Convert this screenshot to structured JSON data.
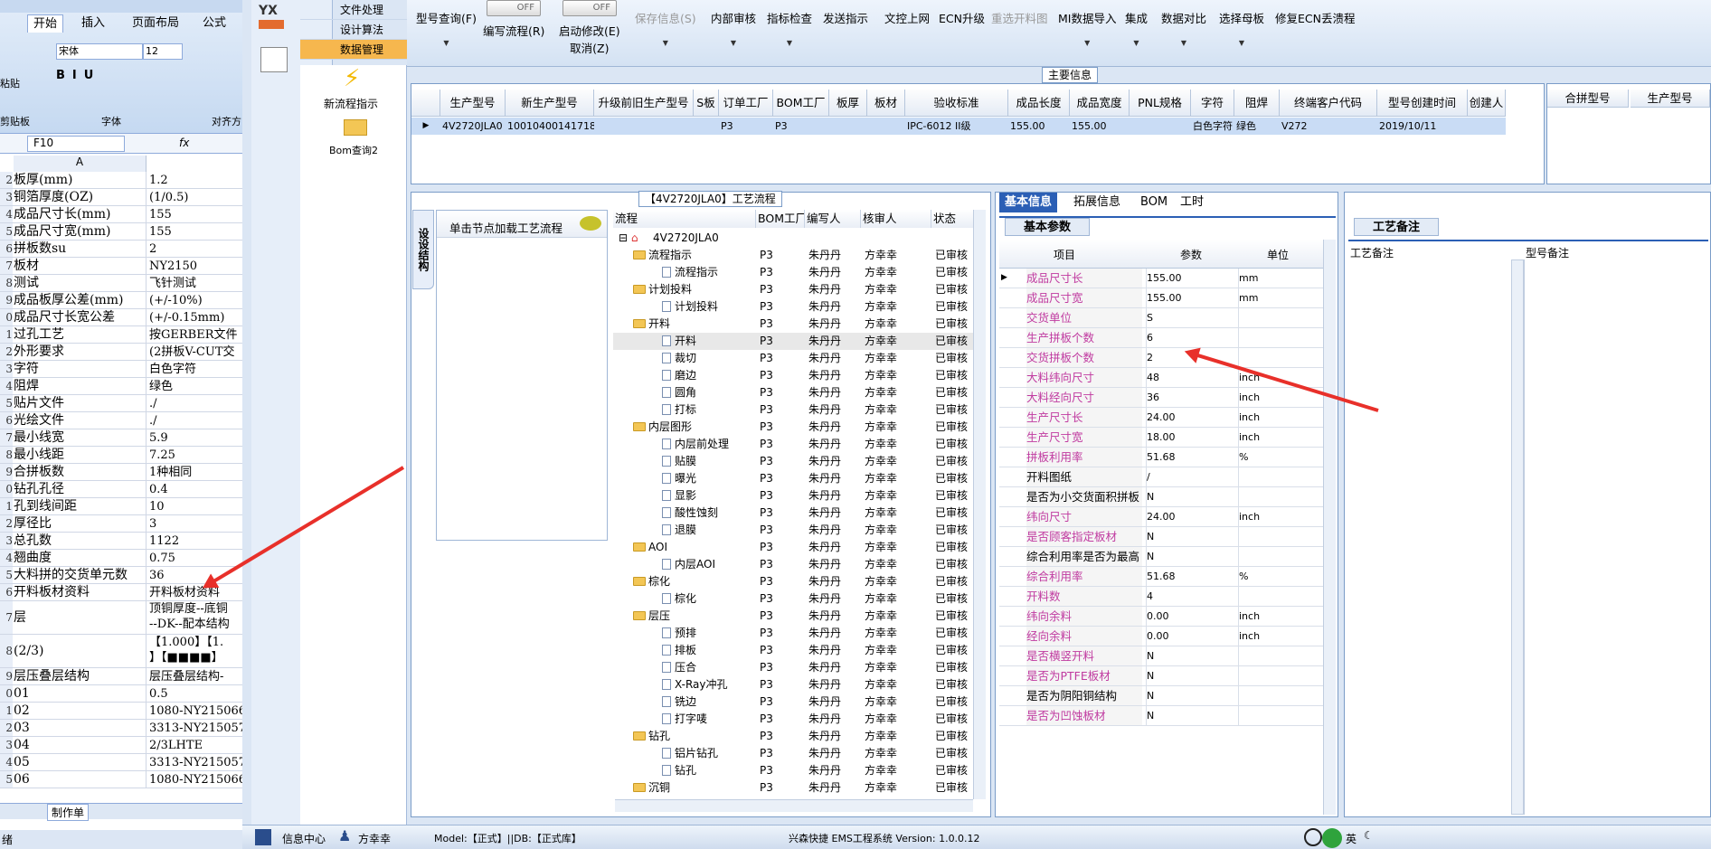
{
  "excel": {
    "tabs": [
      "开始",
      "插入",
      "页面布局",
      "公式"
    ],
    "font_name": "宋体",
    "font_size": "12",
    "group_labels": [
      "粘贴",
      "剪贴板",
      "字体",
      "对齐方"
    ],
    "name_box": "F10",
    "fx": "fx",
    "col_a": "A",
    "rows": [
      {
        "n": "2",
        "a": "板厚(mm)",
        "b": "1.2"
      },
      {
        "n": "3",
        "a": "铜箔厚度(OZ)",
        "b": "(1/0.5)"
      },
      {
        "n": "4",
        "a": "成品尺寸长(mm)",
        "b": "155"
      },
      {
        "n": "5",
        "a": "成品尺寸宽(mm)",
        "b": "155"
      },
      {
        "n": "6",
        "a": "拼板数su",
        "b": "2"
      },
      {
        "n": "7",
        "a": "板材",
        "b": "NY2150"
      },
      {
        "n": "8",
        "a": "测试",
        "b": "飞针测试"
      },
      {
        "n": "9",
        "a": "成品板厚公差(mm)",
        "b": "(+/-10%)"
      },
      {
        "n": "0",
        "a": "成品尺寸长宽公差",
        "b": "(+/-0.15mm)"
      },
      {
        "n": "1",
        "a": "过孔工艺",
        "b": "按GERBER文件"
      },
      {
        "n": "2",
        "a": "外形要求",
        "b": "(2拼板V-CUT交"
      },
      {
        "n": "3",
        "a": "字符",
        "b": "白色字符"
      },
      {
        "n": "4",
        "a": "阻焊",
        "b": "绿色"
      },
      {
        "n": "5",
        "a": "贴片文件",
        "b": "./"
      },
      {
        "n": "6",
        "a": "光绘文件",
        "b": "./"
      },
      {
        "n": "7",
        "a": "最小线宽",
        "b": "5.9"
      },
      {
        "n": "8",
        "a": "最小线距",
        "b": "7.25"
      },
      {
        "n": "9",
        "a": "合拼板数",
        "b": "1种相同"
      },
      {
        "n": "0",
        "a": "钻孔孔径",
        "b": "0.4"
      },
      {
        "n": "1",
        "a": "孔到线间距",
        "b": "10"
      },
      {
        "n": "2",
        "a": "厚径比",
        "b": "3"
      },
      {
        "n": "3",
        "a": "总孔数",
        "b": "1122"
      },
      {
        "n": "4",
        "a": "翘曲度",
        "b": "0.75"
      },
      {
        "n": "5",
        "a": "大料拼的交货单元数",
        "b": "36"
      },
      {
        "n": "6",
        "a": "开料板材资料",
        "b": "开料板材资料"
      }
    ],
    "row_layer": {
      "n": "7",
      "a": "层",
      "b1": "顶铜厚度--底铜",
      "b2": "--DK--配本结构"
    },
    "row_23": {
      "n": "8",
      "a": "(2/3)",
      "b1": "【1.000】【1.",
      "b2": "】【■■■■】"
    },
    "rows2": [
      {
        "n": "9",
        "a": "层压叠层结构",
        "b": "层压叠层结构-"
      },
      {
        "n": "0",
        "a": "01",
        "b": "0.5"
      },
      {
        "n": "1",
        "a": "02",
        "b": "1080-NY215066"
      },
      {
        "n": "2",
        "a": "03",
        "b": "3313-NY215057"
      },
      {
        "n": "3",
        "a": "04",
        "b": "2/3LHTE"
      },
      {
        "n": "4",
        "a": "05",
        "b": "3313-NY215057"
      },
      {
        "n": "5",
        "a": "06",
        "b": "1080-NY215066"
      }
    ],
    "sheet_tab": "制作单",
    "status": "绪"
  },
  "nav": {
    "logo": "YX",
    "menu": [
      "文件处理",
      "设计算法",
      "数据管理"
    ],
    "items": [
      "新流程指示",
      "Bom查询2"
    ]
  },
  "toolbar": {
    "items": [
      "型号查询(F)",
      "编写流程(R)",
      "启动修改(E)",
      "取消(Z)",
      "保存信息(S)",
      "内部审核",
      "指标检查",
      "发送指示",
      "文控上网",
      "ECN升级",
      "重选开料图",
      "MI数据导入",
      "集成",
      "数据对比",
      "选择母板",
      "修复ECN丢溃程"
    ],
    "toggle": "OFF"
  },
  "main_info": {
    "title": "主要信息",
    "headers": [
      "生产型号",
      "新生产型号",
      "升级前旧生产型号",
      "S板",
      "订单工厂",
      "BOM工厂",
      "板厚",
      "板材",
      "验收标准",
      "成品长度",
      "成品宽度",
      "PNL规格",
      "字符",
      "阻焊",
      "终端客户代码",
      "型号创建时间",
      "创建人"
    ],
    "row": [
      "4V2720JLA0",
      "10010400141718",
      "",
      "",
      "P3",
      "P3",
      "",
      "",
      "IPC-6012 II级",
      "155.00",
      "155.00",
      "",
      "白色字符",
      "绿色",
      "V272",
      "2019/10/11",
      ""
    ],
    "merge_headers": [
      "合拼型号",
      "生产型号"
    ]
  },
  "process": {
    "title": "【4V2720JLA0】工艺流程",
    "side_tab": "设设结构",
    "load_hint": "单击节点加载工艺流程",
    "headers": [
      "流程",
      "BOM工厂",
      "编写人",
      "核审人",
      "状态"
    ],
    "root": "4V2720JLA0",
    "rows": [
      {
        "name": "流程指示",
        "folder": true,
        "lvl": 1
      },
      {
        "name": "流程指示",
        "folder": false,
        "lvl": 2
      },
      {
        "name": "计划投料",
        "folder": true,
        "lvl": 1
      },
      {
        "name": "计划投料",
        "folder": false,
        "lvl": 2
      },
      {
        "name": "开料",
        "folder": true,
        "lvl": 1
      },
      {
        "name": "开料",
        "folder": false,
        "lvl": 2,
        "hl": true
      },
      {
        "name": "裁切",
        "folder": false,
        "lvl": 2
      },
      {
        "name": "磨边",
        "folder": false,
        "lvl": 2
      },
      {
        "name": "圆角",
        "folder": false,
        "lvl": 2
      },
      {
        "name": "打标",
        "folder": false,
        "lvl": 2
      },
      {
        "name": "内层图形",
        "folder": true,
        "lvl": 1
      },
      {
        "name": "内层前处理",
        "folder": false,
        "lvl": 2
      },
      {
        "name": "贴膜",
        "folder": false,
        "lvl": 2
      },
      {
        "name": "曝光",
        "folder": false,
        "lvl": 2
      },
      {
        "name": "显影",
        "folder": false,
        "lvl": 2
      },
      {
        "name": "酸性蚀刻",
        "folder": false,
        "lvl": 2
      },
      {
        "name": "退膜",
        "folder": false,
        "lvl": 2
      },
      {
        "name": "AOI",
        "folder": true,
        "lvl": 1
      },
      {
        "name": "内层AOI",
        "folder": false,
        "lvl": 2
      },
      {
        "name": "棕化",
        "folder": true,
        "lvl": 1
      },
      {
        "name": "棕化",
        "folder": false,
        "lvl": 2
      },
      {
        "name": "层压",
        "folder": true,
        "lvl": 1
      },
      {
        "name": "预排",
        "folder": false,
        "lvl": 2
      },
      {
        "name": "排板",
        "folder": false,
        "lvl": 2
      },
      {
        "name": "压合",
        "folder": false,
        "lvl": 2
      },
      {
        "name": "X-Ray冲孔",
        "folder": false,
        "lvl": 2
      },
      {
        "name": "铣边",
        "folder": false,
        "lvl": 2
      },
      {
        "name": "打字唛",
        "folder": false,
        "lvl": 2
      },
      {
        "name": "钻孔",
        "folder": true,
        "lvl": 1
      },
      {
        "name": "铝片钻孔",
        "folder": false,
        "lvl": 2
      },
      {
        "name": "钻孔",
        "folder": false,
        "lvl": 2
      },
      {
        "name": "沉铜",
        "folder": true,
        "lvl": 1
      }
    ],
    "bom": "P3",
    "writer": "朱丹丹",
    "reviewer": "方幸幸",
    "status": "已审核"
  },
  "basic": {
    "tabs": [
      "基本信息",
      "拓展信息",
      "BOM",
      "工时"
    ],
    "subtab": "基本参数",
    "headers": [
      "项目",
      "参数",
      "单位"
    ],
    "rows": [
      {
        "k": "成品尺寸长",
        "v": "155.00",
        "u": "mm",
        "pink": true
      },
      {
        "k": "成品尺寸宽",
        "v": "155.00",
        "u": "mm",
        "pink": true
      },
      {
        "k": "交货单位",
        "v": "S",
        "u": "",
        "pink": true
      },
      {
        "k": "生产拼板个数",
        "v": "6",
        "u": "",
        "pink": true
      },
      {
        "k": "交货拼板个数",
        "v": "2",
        "u": "",
        "pink": true
      },
      {
        "k": "大料纬向尺寸",
        "v": "48",
        "u": "inch",
        "pink": true
      },
      {
        "k": "大料经向尺寸",
        "v": "36",
        "u": "inch",
        "pink": true
      },
      {
        "k": "生产尺寸长",
        "v": "24.00",
        "u": "inch",
        "pink": true
      },
      {
        "k": "生产尺寸宽",
        "v": "18.00",
        "u": "inch",
        "pink": true
      },
      {
        "k": "拼板利用率",
        "v": "51.68",
        "u": "%",
        "pink": true
      },
      {
        "k": "开料图纸",
        "v": "/",
        "u": "",
        "pink": false
      },
      {
        "k": "是否为小交货面积拼板",
        "v": "N",
        "u": "",
        "pink": false
      },
      {
        "k": "纬向尺寸",
        "v": "24.00",
        "u": "inch",
        "pink": true
      },
      {
        "k": "是否顾客指定板材",
        "v": "N",
        "u": "",
        "pink": true
      },
      {
        "k": "综合利用率是否为最高",
        "v": "N",
        "u": "",
        "pink": false
      },
      {
        "k": "综合利用率",
        "v": "51.68",
        "u": "%",
        "pink": true
      },
      {
        "k": "开料数",
        "v": "4",
        "u": "",
        "pink": true
      },
      {
        "k": "纬向余料",
        "v": "0.00",
        "u": "inch",
        "pink": true
      },
      {
        "k": "经向余料",
        "v": "0.00",
        "u": "inch",
        "pink": true
      },
      {
        "k": "是否横竖开料",
        "v": "N",
        "u": "",
        "pink": true
      },
      {
        "k": "是否为PTFE板材",
        "v": "N",
        "u": "",
        "pink": true
      },
      {
        "k": "是否为阴阳铜结构",
        "v": "N",
        "u": "",
        "pink": false
      },
      {
        "k": "是否为凹蚀板材",
        "v": "N",
        "u": "",
        "pink": true
      }
    ]
  },
  "notes": {
    "tab": "工艺备注",
    "headers": [
      "工艺备注",
      "型号备注"
    ]
  },
  "status": {
    "info_center": "信息中心",
    "user": "方幸幸",
    "model": "Model:【正式】||DB:【正式库】",
    "system": "兴森快捷  EMS工程系统  Version: 1.0.0.12",
    "ime": "英"
  },
  "colors": {
    "pink_label": "#c03aa0",
    "accent": "#2b5fb5",
    "arrow": "#e8302a"
  }
}
